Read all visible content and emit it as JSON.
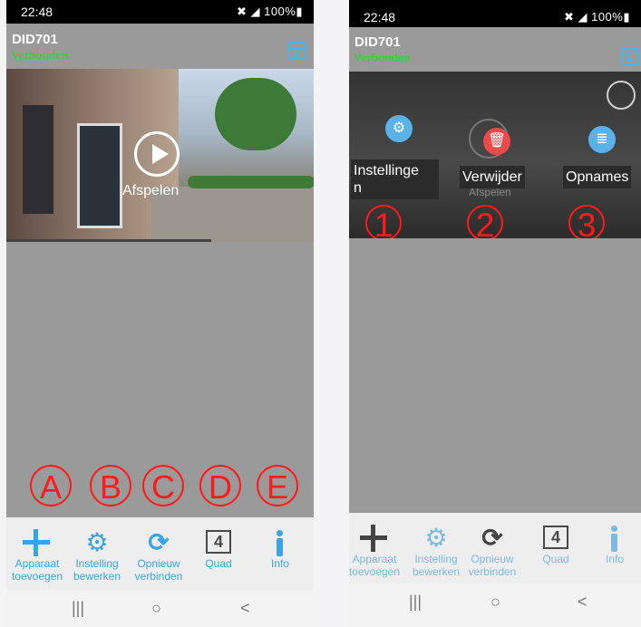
{
  "status": {
    "time": "22:48",
    "signal": "✖⁡ ◢ 100%▮"
  },
  "device": {
    "name": "DID701",
    "status": "Verbonden"
  },
  "video": {
    "play_label": "Afspelen"
  },
  "overlay": {
    "settings_label": "Instellinge\nn",
    "delete_label": "Verwijder",
    "recordings_label": "Opnames",
    "faint_label": "Afspelen"
  },
  "markers_numbers": [
    "1",
    "2",
    "3"
  ],
  "markers_letters": [
    "A",
    "B",
    "C",
    "D",
    "E"
  ],
  "bottom_nav": [
    {
      "label": "Apparaat\ntoevoegen",
      "icon": "plus-icon"
    },
    {
      "label": "Instelling\nbewerken",
      "icon": "gear-icon"
    },
    {
      "label": "Opnieuw\nverbinden",
      "icon": "refresh-icon"
    },
    {
      "label": "Quad",
      "icon": "quad-icon",
      "value": "4"
    },
    {
      "label": "Info",
      "icon": "info-icon"
    }
  ],
  "system_nav": {
    "recent": "|||",
    "home": "○",
    "back": "<"
  },
  "colors": {
    "accent": "#3aa3e6",
    "connected": "#3dce3d",
    "marker": "#ff1a1a",
    "delete": "#e94b4b"
  }
}
